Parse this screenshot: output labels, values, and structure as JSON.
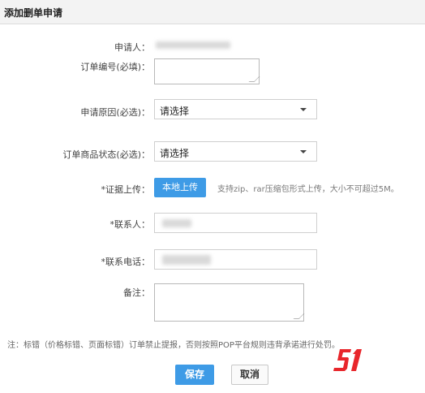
{
  "header": {
    "title": "添加删单申请"
  },
  "form": {
    "applicant_label": "申请人：",
    "order_no_label": "订单编号(必填)：",
    "reason_label": "申请原因(必选)：",
    "reason_value": "请选择",
    "status_label": "订单商品状态(必选)：",
    "status_value": "请选择",
    "upload_label": "*证据上传：",
    "upload_button": "本地上传",
    "upload_hint": "支持zip、rar压缩包形式上传，大小不可超过5M。",
    "contact_label": "*联系人：",
    "phone_label": "*联系电话：",
    "remark_label": "备注："
  },
  "note": "注：标错（价格标错、页面标错）订单禁止提报，否则按照POP平台规则违背承诺进行处罚。",
  "buttons": {
    "save": "保存",
    "cancel": "取消"
  },
  "watermark": {
    "text": "51",
    "color": "#e8262b"
  },
  "colors": {
    "accent": "#3e9be6"
  }
}
